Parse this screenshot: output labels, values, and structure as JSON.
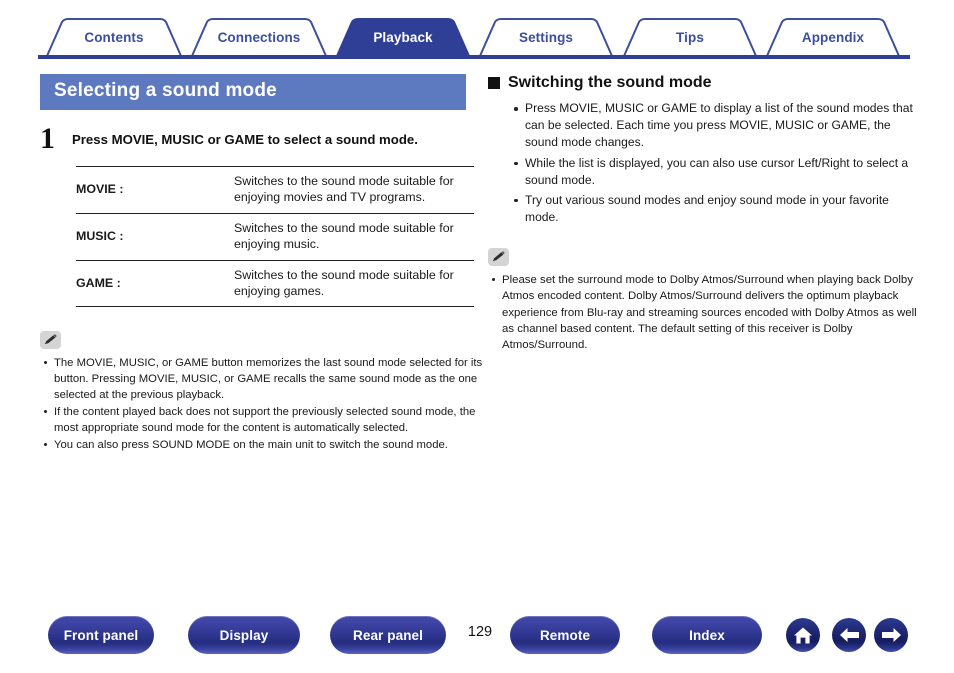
{
  "tabs": [
    {
      "label": "Contents",
      "active": false
    },
    {
      "label": "Connections",
      "active": false
    },
    {
      "label": "Playback",
      "active": true
    },
    {
      "label": "Settings",
      "active": false
    },
    {
      "label": "Tips",
      "active": false
    },
    {
      "label": "Appendix",
      "active": false
    }
  ],
  "colors": {
    "tab_border": "#3c4f9e",
    "tab_active_bg": "#2f3f96",
    "section_title_bg": "#5d7ac0",
    "footer_button": "#2f3790",
    "text": "#1a1a1a"
  },
  "left": {
    "section_title": "Selecting a sound mode",
    "step": {
      "number": "1",
      "text": "Press MOVIE, MUSIC or GAME to select a sound mode."
    },
    "table": {
      "rows": [
        {
          "key": "MOVIE :",
          "desc": "Switches to the sound mode suitable for enjoying movies and TV programs."
        },
        {
          "key": "MUSIC :",
          "desc": "Switches to the sound mode suitable for enjoying music."
        },
        {
          "key": "GAME :",
          "desc": "Switches to the sound mode suitable for enjoying games."
        }
      ]
    },
    "note": {
      "icon": "pencil-note-icon",
      "items": [
        "The MOVIE, MUSIC, or GAME button memorizes the last sound mode selected for its button. Pressing MOVIE, MUSIC, or GAME recalls the same sound mode as the one selected at the previous playback.",
        "If the content played back does not support the previously selected sound mode, the most appropriate sound mode for the content is automatically selected.",
        "You can also press SOUND MODE on the main unit to switch the sound mode."
      ]
    }
  },
  "right": {
    "heading": "Switching the sound mode",
    "bullets": [
      "Press MOVIE, MUSIC or GAME to display a list of the sound modes that can be selected. Each time you press MOVIE, MUSIC or GAME, the sound mode changes.",
      "While the list is displayed, you can also use cursor Left/Right to select a sound mode.",
      "Try out various sound modes and enjoy sound mode in your favorite mode."
    ],
    "note": {
      "icon": "pencil-note-icon",
      "items": [
        "Please set the surround mode to Dolby Atmos/Surround when playing back Dolby Atmos encoded content. Dolby Atmos/Surround delivers the optimum playback experience from Blu-ray and streaming sources encoded with Dolby Atmos as well as channel based content. The default setting of this receiver is Dolby Atmos/Surround."
      ]
    }
  },
  "footer": {
    "buttons": [
      {
        "label": "Front panel"
      },
      {
        "label": "Display"
      },
      {
        "label": "Rear panel"
      },
      {
        "label": "Remote"
      },
      {
        "label": "Index"
      }
    ],
    "page_number": "129",
    "icons": [
      {
        "name": "home-icon"
      },
      {
        "name": "arrow-left-icon"
      },
      {
        "name": "arrow-right-icon"
      }
    ]
  }
}
